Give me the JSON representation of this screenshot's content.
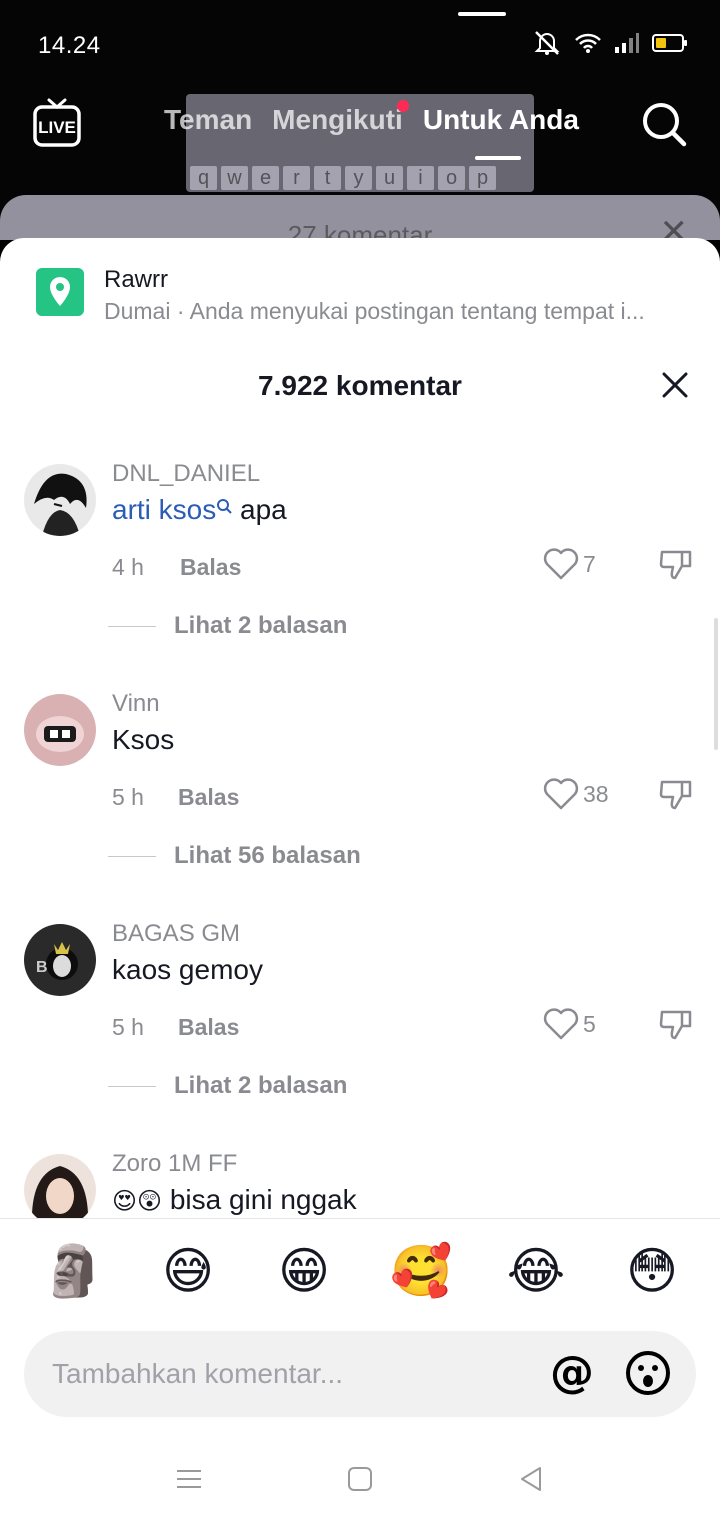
{
  "status_bar": {
    "time": "14.24",
    "icons": [
      "mute-icon",
      "wifi-icon",
      "signal-icon",
      "battery-icon"
    ]
  },
  "top_nav": {
    "live_label": "LIVE",
    "tabs": [
      {
        "label": "Teman",
        "active": false
      },
      {
        "label": "Mengikuti",
        "active": false,
        "has_dot": true
      },
      {
        "label": "Untuk Anda",
        "active": true
      }
    ]
  },
  "background_video": {
    "keyboard_keys": [
      "q",
      "w",
      "e",
      "r",
      "t",
      "y",
      "u",
      "i",
      "o",
      "p"
    ],
    "ghost_comment_count": "27 komentar"
  },
  "location_banner": {
    "title": "Rawrr",
    "subtitle": "Dumai · Anda menyukai postingan tentang tempat i..."
  },
  "comments_header": {
    "title": "7.922 komentar"
  },
  "comments": [
    {
      "username": "DNL_DANIEL",
      "text_keyword": "arti ksos",
      "text": " apa",
      "time": "4 h",
      "reply_label": "Balas",
      "likes": "7",
      "view_replies": "Lihat 2 balasan"
    },
    {
      "username": "Vinn",
      "text_keyword": "",
      "text": "Ksos",
      "time": "5 h",
      "reply_label": "Balas",
      "likes": "38",
      "view_replies": "Lihat 56 balasan"
    },
    {
      "username": "BAGAS GM",
      "text_keyword": "",
      "text": "kaos gemoy",
      "time": "5 h",
      "reply_label": "Balas",
      "likes": "5",
      "view_replies": "Lihat 2 balasan"
    },
    {
      "username": "Zoro 1M FF",
      "text_keyword": "",
      "text_emojis": "😍😲",
      "text": " bisa gini nggak",
      "time": "",
      "reply_label": "",
      "likes": "",
      "view_replies": ""
    }
  ],
  "quick_emojis": [
    "🗿",
    "😅",
    "😁",
    "🥰",
    "😂",
    "😳"
  ],
  "comment_input": {
    "placeholder": "Tambahkan komentar..."
  },
  "colors": {
    "accent_link": "#2b5db5",
    "location_icon": "#25c384",
    "notification_dot": "#fe2c55",
    "secondary_text": "#8a8b91"
  }
}
